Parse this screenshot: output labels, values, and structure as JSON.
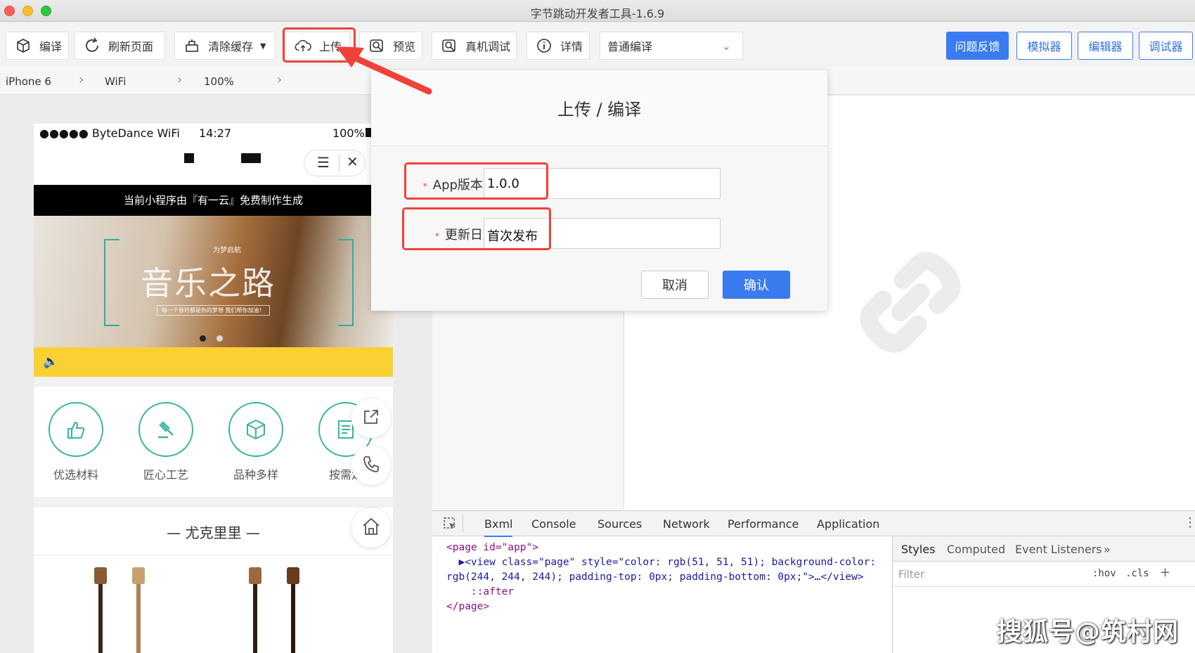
{
  "window": {
    "title": "字节跳动开发者工具-1.6.9"
  },
  "toolbar": {
    "compile_label": "编译",
    "refresh_label": "刷新页面",
    "clear_cache_label": "清除缓存",
    "upload_label": "上传",
    "preview_label": "预览",
    "remote_debug_label": "真机调试",
    "details_label": "详情",
    "compile_mode": "普通编译",
    "feedback_label": "问题反馈",
    "simulator_label": "模拟器",
    "editor_label": "编辑器",
    "debugger_label": "调试器"
  },
  "device_bar": {
    "device": "iPhone 6",
    "network": "WiFi",
    "zoom": "100%"
  },
  "phone": {
    "status": {
      "carrier": "●●●●● ByteDance WiFi",
      "time": "14:27",
      "battery": "100%"
    },
    "banner": "当前小程序由『有一云』免费制作生成",
    "hero": {
      "title": "音乐之路",
      "subtitle": "为梦启航",
      "caption": "每一个音符都是你的梦想 我们帮你加油！"
    },
    "features": [
      {
        "label": "优选材料",
        "icon": "thumbs-up-icon"
      },
      {
        "label": "匠心工艺",
        "icon": "gavel-icon"
      },
      {
        "label": "品种多样",
        "icon": "cube-icon"
      },
      {
        "label": "按需定",
        "icon": "document-icon"
      }
    ],
    "section_title": "— 尤克里里 —"
  },
  "modal": {
    "title": "上传 / 编译",
    "version_label": "App版本号:",
    "version_value": "1.0.0",
    "changelog_label": "更新日志:",
    "changelog_value": "首次发布",
    "cancel_label": "取消",
    "confirm_label": "确认"
  },
  "devtools": {
    "tabs": [
      "Bxml",
      "Console",
      "Sources",
      "Network",
      "Performance",
      "Application"
    ],
    "code_lines": [
      "<page id=\"app\">",
      "  ▶<view class=\"page\" style=\"color: rgb(51, 51, 51); background-color:",
      "rgb(244, 244, 244); padding-top: 0px; padding-bottom: 0px;\">…</view>",
      "    ::after",
      "</page>"
    ],
    "styles_tabs": [
      "Styles",
      "Computed",
      "Event Listeners",
      "»"
    ],
    "filter_placeholder": "Filter",
    "hov_label": ":hov",
    "cls_label": ".cls",
    "add_label": "+"
  },
  "watermark": "搜狐号@筑村网",
  "colors": {
    "accent": "#3a7cf0",
    "highlight": "#f0423a",
    "brand_green": "#3ab49c",
    "yellow": "#fad033"
  }
}
